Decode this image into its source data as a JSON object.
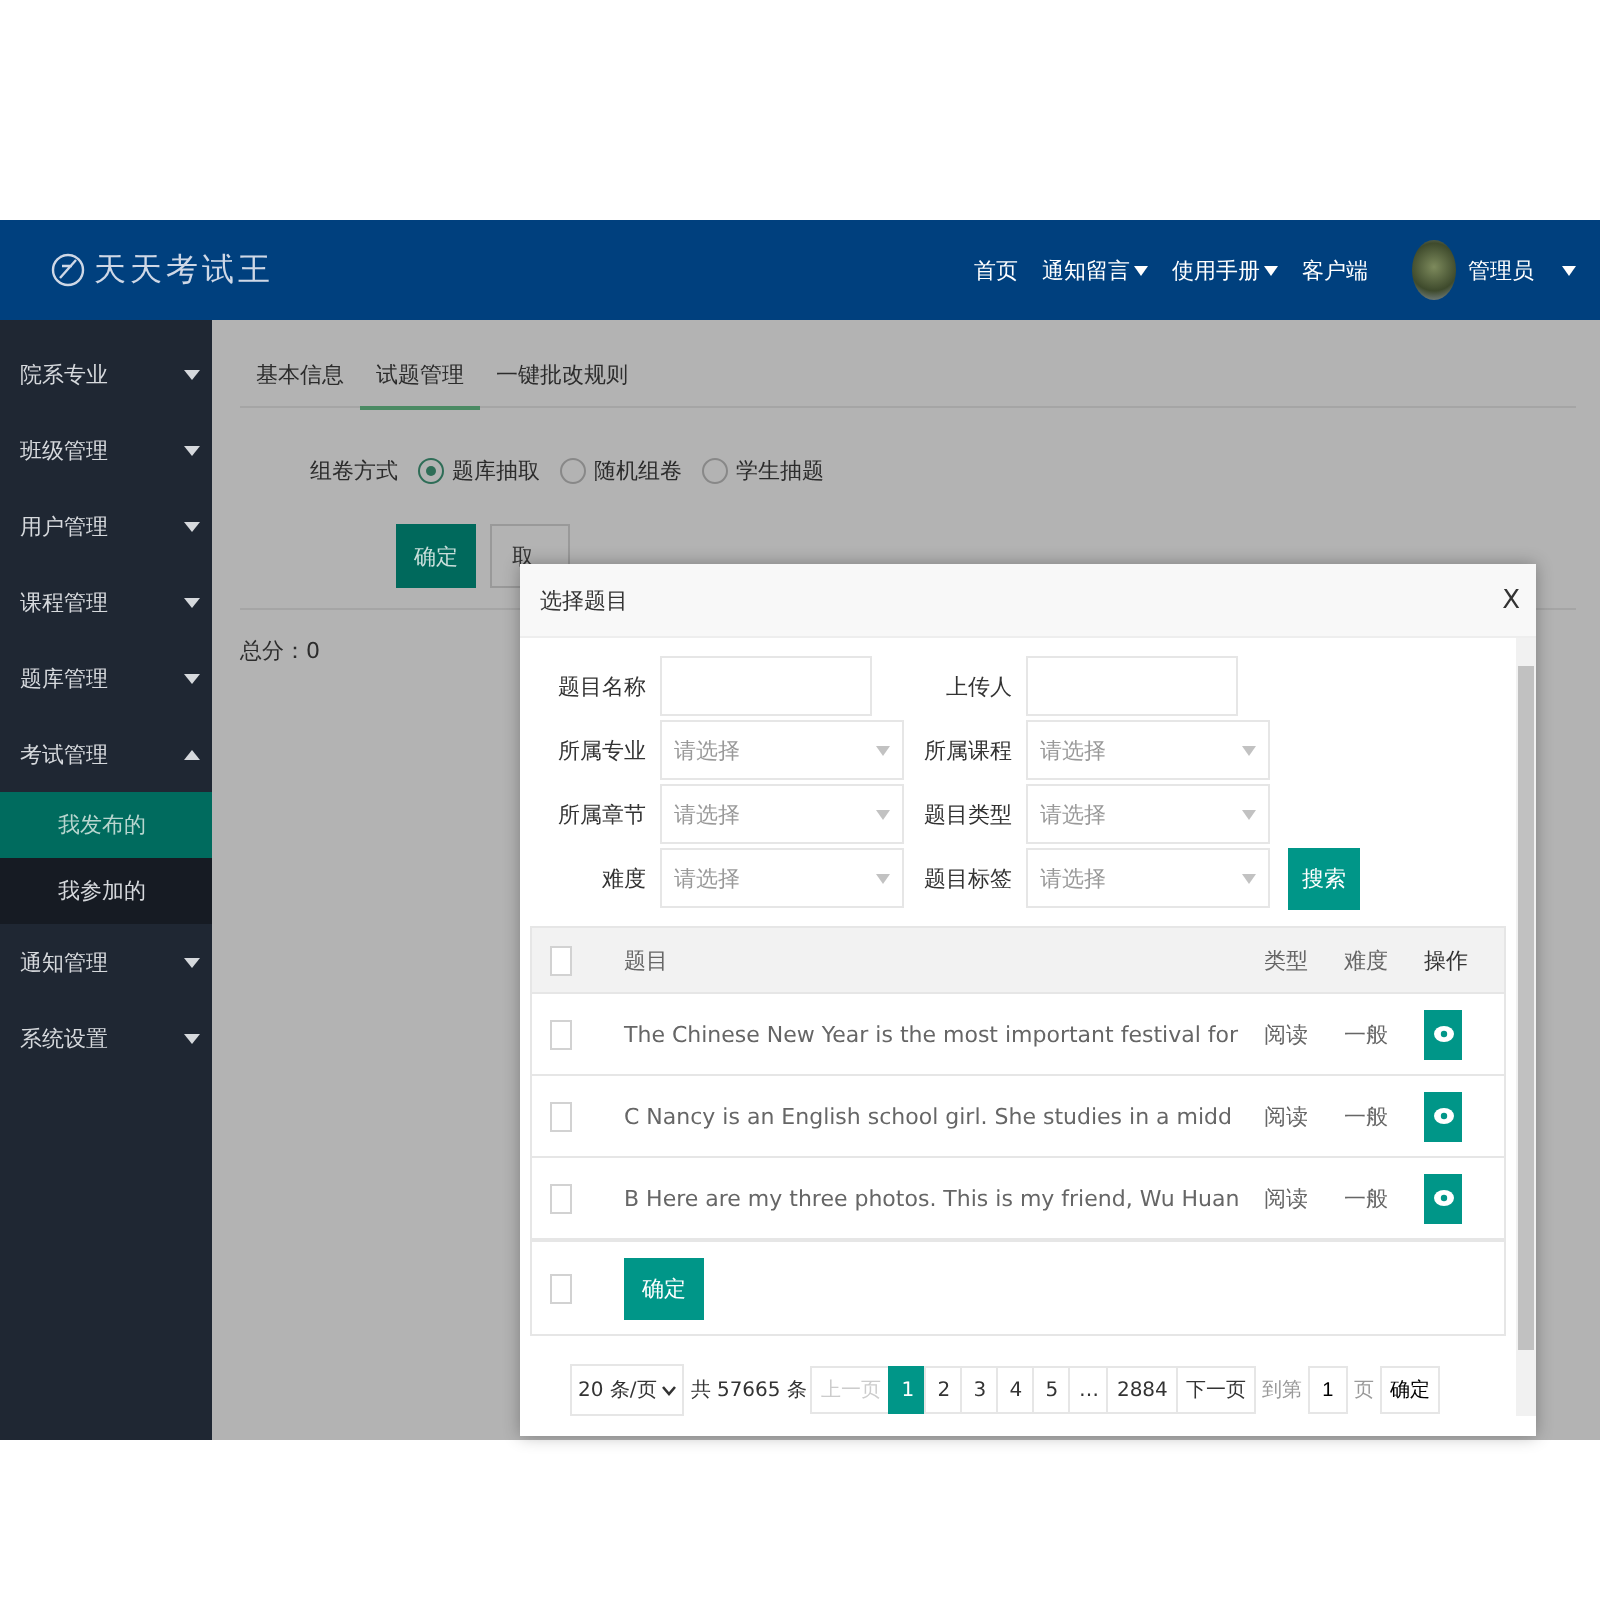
{
  "header": {
    "logo_text": "天天考试王",
    "nav": [
      {
        "label": "首页",
        "dropdown": false
      },
      {
        "label": "通知留言",
        "dropdown": true
      },
      {
        "label": "使用手册",
        "dropdown": true
      },
      {
        "label": "客户端",
        "dropdown": false
      }
    ],
    "user": "管理员"
  },
  "sidebar": {
    "items": [
      {
        "label": "院系专业",
        "expanded": false
      },
      {
        "label": "班级管理",
        "expanded": false
      },
      {
        "label": "用户管理",
        "expanded": false
      },
      {
        "label": "课程管理",
        "expanded": false
      },
      {
        "label": "题库管理",
        "expanded": false
      },
      {
        "label": "考试管理",
        "expanded": true,
        "children": [
          {
            "label": "我发布的",
            "selected": true
          },
          {
            "label": "我参加的",
            "selected": false
          }
        ]
      },
      {
        "label": "通知管理",
        "expanded": false
      },
      {
        "label": "系统设置",
        "expanded": false
      }
    ]
  },
  "tabs": [
    {
      "label": "基本信息",
      "selected": false
    },
    {
      "label": "试题管理",
      "selected": true
    },
    {
      "label": "一键批改规则",
      "selected": false
    }
  ],
  "compose": {
    "label": "组卷方式",
    "options": [
      {
        "label": "题库抽取",
        "selected": true
      },
      {
        "label": "随机组卷",
        "selected": false
      },
      {
        "label": "学生抽题",
        "selected": false
      }
    ]
  },
  "buttons": {
    "confirm": "确定",
    "cancel": "取"
  },
  "total": "总分：0",
  "dialog": {
    "title": "选择题目",
    "close": "X",
    "filters": [
      {
        "label": "题目名称",
        "kind": "input"
      },
      {
        "label": "上传人",
        "kind": "input"
      },
      {
        "label": "所属专业",
        "kind": "select",
        "placeholder": "请选择"
      },
      {
        "label": "所属课程",
        "kind": "select",
        "placeholder": "请选择"
      },
      {
        "label": "所属章节",
        "kind": "select",
        "placeholder": "请选择"
      },
      {
        "label": "题目类型",
        "kind": "select",
        "placeholder": "请选择"
      },
      {
        "label": "难度",
        "kind": "select",
        "placeholder": "请选择"
      },
      {
        "label": "题目标签",
        "kind": "select",
        "placeholder": "请选择"
      }
    ],
    "search": "搜索",
    "table": {
      "columns": [
        "题目",
        "类型",
        "难度",
        "操作"
      ],
      "select_all_checked": false,
      "footer_checked": false,
      "rows": [
        {
          "checked": false,
          "title": "The Chinese New Year is the most important festival for",
          "type": "阅读",
          "level": "一般"
        },
        {
          "checked": false,
          "title": "C Nancy is an English school girl. She studies in a midd",
          "type": "阅读",
          "level": "一般"
        },
        {
          "checked": false,
          "title": "B Here are my three photos. This is my friend, Wu Huan",
          "type": "阅读",
          "level": "一般"
        }
      ],
      "footer_button": "确定"
    },
    "pagination": {
      "page_size": "20 条/页",
      "total": "共 57665 条",
      "prev": "上一页",
      "pages": [
        {
          "label": "1",
          "selected": true
        },
        {
          "label": "2",
          "selected": false
        },
        {
          "label": "3",
          "selected": false
        },
        {
          "label": "4",
          "selected": false
        },
        {
          "label": "5",
          "selected": false
        },
        {
          "label": "…",
          "selected": false
        },
        {
          "label": "2884",
          "selected": false
        }
      ],
      "next": "下一页",
      "goto": "到第",
      "page_value": "1",
      "page_unit": "页",
      "go": "确定"
    }
  }
}
